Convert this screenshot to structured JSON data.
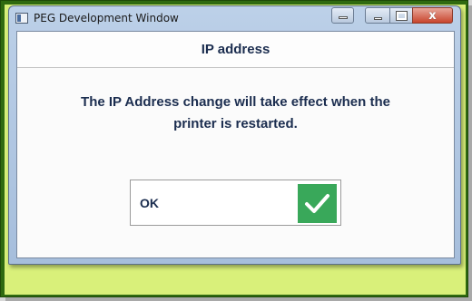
{
  "window": {
    "title": "PEG Development Window",
    "close_glyph": "x"
  },
  "dialog": {
    "header": "IP address",
    "message_line1": "The IP Address change will take effect when the",
    "message_line2": "printer is restarted.",
    "ok_label": "OK",
    "ok_icon": "checkmark-icon",
    "accent_color": "#39a85a",
    "text_color": "#1b2d4f"
  },
  "frame_color": "#d9f07a"
}
